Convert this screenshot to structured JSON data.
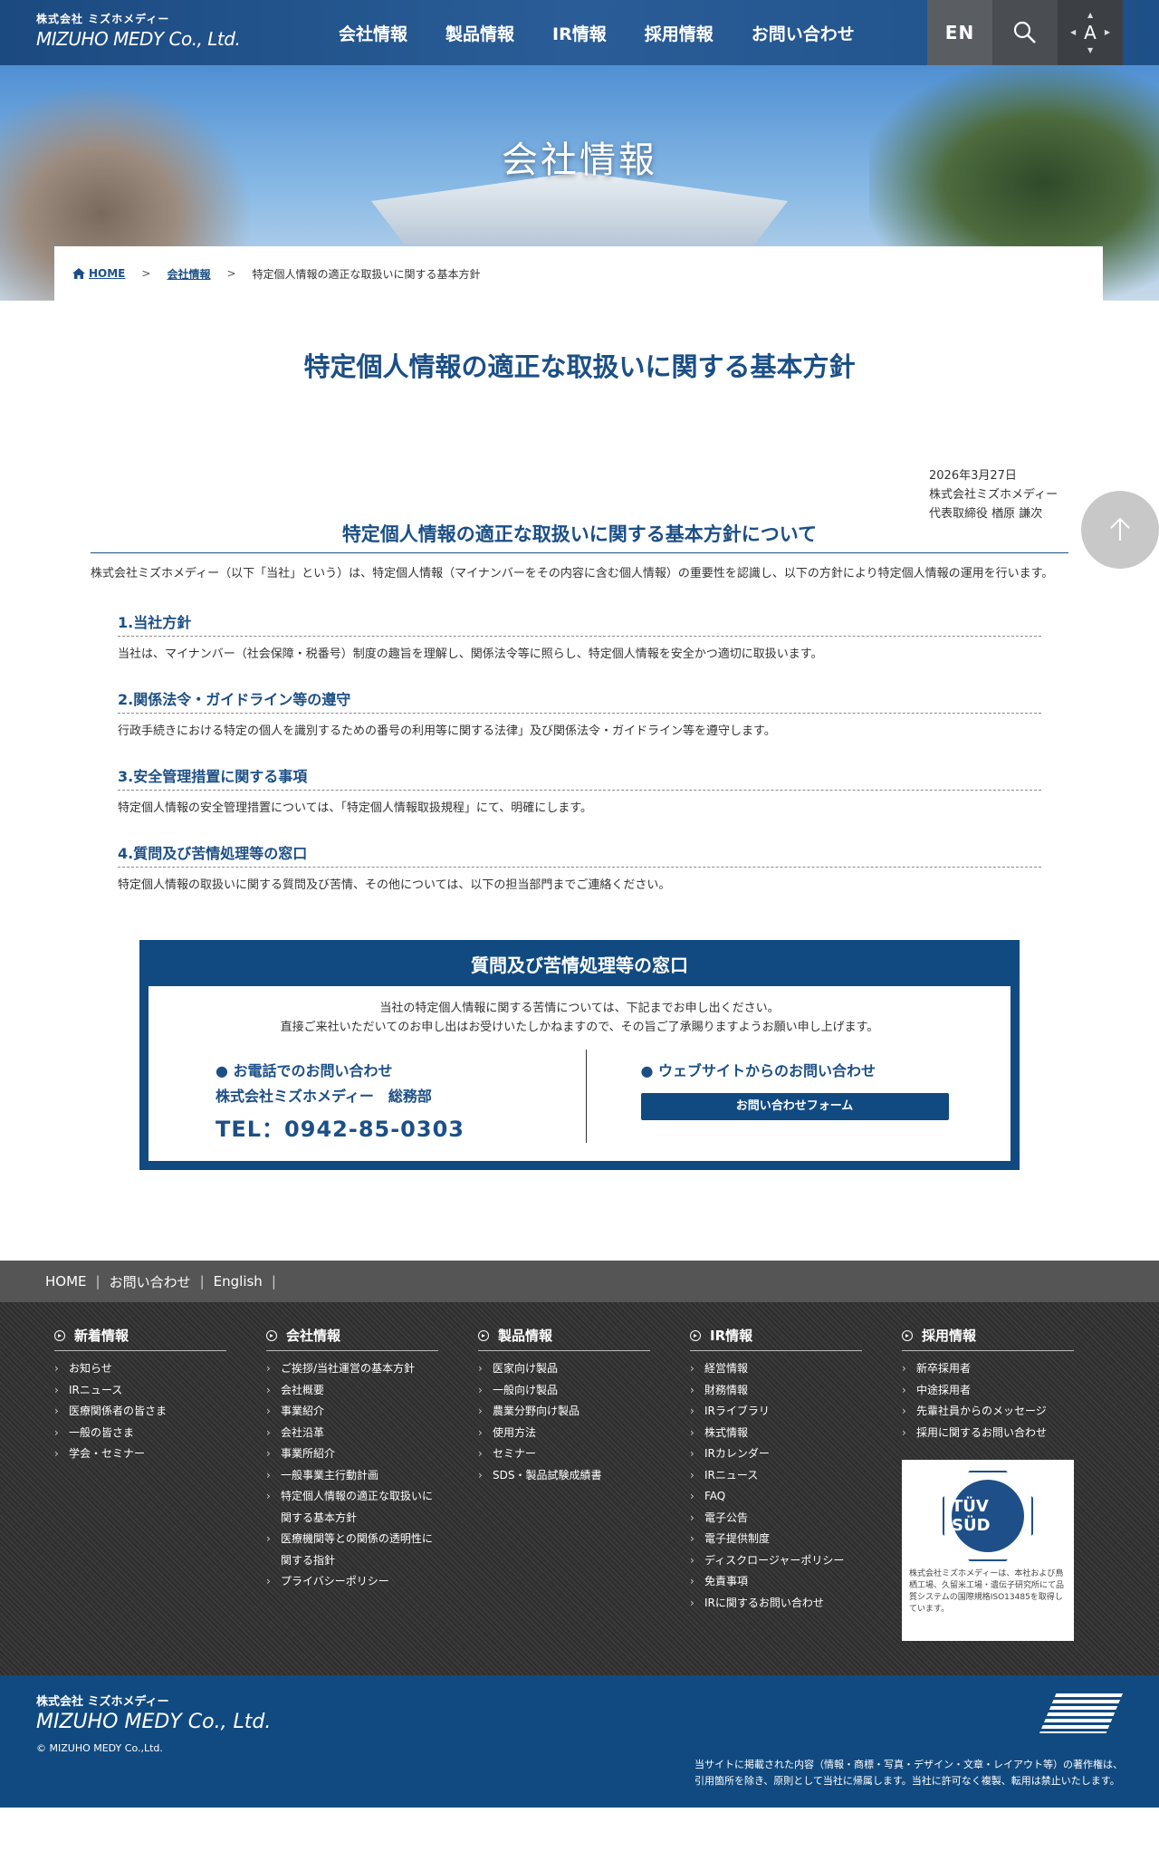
{
  "header": {
    "logo_jp": "株式会社 ミズホメディー",
    "logo_en": "MIZUHO MEDY Co., Ltd.",
    "nav": [
      "会社情報",
      "製品情報",
      "IR情報",
      "採用情報",
      "お問い合わせ"
    ],
    "en_label": "EN",
    "font_label": "A"
  },
  "hero": {
    "title": "会社情報"
  },
  "breadcrumb": {
    "home": "HOME",
    "sep": ">",
    "parent": "会社情報",
    "current": "特定個人情報の適正な取扱いに関する基本方針"
  },
  "page": {
    "title": "特定個人情報の適正な取扱いに関する基本方針",
    "date": "2026年3月27日",
    "company": "株式会社ミズホメディー",
    "signer": "代表取締役 楢原 謙次",
    "section_title": "特定個人情報の適正な取扱いに関する基本方針について",
    "intro": "株式会社ミズホメディー（以下「当社」という）は、特定個人情報（マイナンバーをその内容に含む個人情報）の重要性を認識し、以下の方針により特定個人情報の運用を行います。",
    "items": [
      {
        "heading": "1.当社方針",
        "body": "当社は、マイナンバー（社会保障・税番号）制度の趣旨を理解し、関係法令等に照らし、特定個人情報を安全かつ適切に取扱います。"
      },
      {
        "heading": "2.関係法令・ガイドライン等の遵守",
        "body": "行政手続きにおける特定の個人を識別するための番号の利用等に関する法律」及び関係法令・ガイドライン等を遵守します。"
      },
      {
        "heading": "3.安全管理措置に関する事項",
        "body": "特定個人情報の安全管理措置については、「特定個人情報取扱規程」にて、明確にします。"
      },
      {
        "heading": "4.質問及び苦情処理等の窓口",
        "body": "特定個人情報の取扱いに関する質問及び苦情、その他については、以下の担当部門までご連絡ください。"
      }
    ]
  },
  "contact": {
    "title": "質問及び苦情処理等の窓口",
    "lead1": "当社の特定個人情報に関する苦情については、下記までお申し出ください。",
    "lead2": "直接ご来社いただいてのお申し出はお受けいたしかねますので、その旨ご了承賜りますようお願い申し上げます。",
    "phone_heading": "● お電話でのお問い合わせ",
    "phone_dept": "株式会社ミズホメディー　総務部",
    "phone_number": "TEL：0942-85-0303",
    "web_heading": "● ウェブサイトからのお問い合わせ",
    "form_button": "お問い合わせフォーム"
  },
  "footer": {
    "nav": [
      "HOME",
      "お問い合わせ",
      "English"
    ],
    "columns": [
      {
        "title": "新着情報",
        "items": [
          "お知らせ",
          "IRニュース",
          "医療関係者の皆さま",
          "一般の皆さま",
          "学会・セミナー"
        ]
      },
      {
        "title": "会社情報",
        "items": [
          "ご挨拶/当社運営の基本方針",
          "会社概要",
          "事業紹介",
          "会社沿革",
          "事業所紹介",
          "一般事業主行動計画",
          "特定個人情報の適正な取扱いに関する基本方針",
          "医療機関等との関係の透明性に関する指針",
          "プライバシーポリシー"
        ]
      },
      {
        "title": "製品情報",
        "items": [
          "医家向け製品",
          "一般向け製品",
          "農業分野向け製品",
          "使用方法",
          "セミナー",
          "SDS・製品試験成績書"
        ]
      },
      {
        "title": "IR情報",
        "items": [
          "経営情報",
          "財務情報",
          "IRライブラリ",
          "株式情報",
          "IRカレンダー",
          "IRニュース",
          "FAQ",
          "電子公告",
          "電子提供制度",
          "ディスクロージャーポリシー",
          "免責事項",
          "IRに関するお問い合わせ"
        ]
      },
      {
        "title": "採用情報",
        "items": [
          "新卒採用者",
          "中途採用者",
          "先輩社員からのメッセージ",
          "採用に関するお問い合わせ"
        ]
      }
    ],
    "tuv_label": "TÜV SÜD",
    "tuv_caption": "株式会社ミズホメディーは、本社および鳥栖工場、久留米工場・遺伝子研究所にて品質システムの国際規格ISO13485を取得しています。",
    "logo_jp": "株式会社 ミズホメディー",
    "logo_en": "MIZUHO MEDY Co., Ltd.",
    "copyright": "© MIZUHO MEDY Co.,Ltd.",
    "note1": "当サイトに掲載された内容（情報・商標・写真・デザイン・文章・レイアウト等）の著作権は、",
    "note2": "引用箇所を除き、原則として当社に帰属します。当社に許可なく複製、転用は禁止いたします。"
  },
  "colors": {
    "primary": "#114a80",
    "accent": "#1c4f86",
    "footer_gray": "#555555"
  }
}
